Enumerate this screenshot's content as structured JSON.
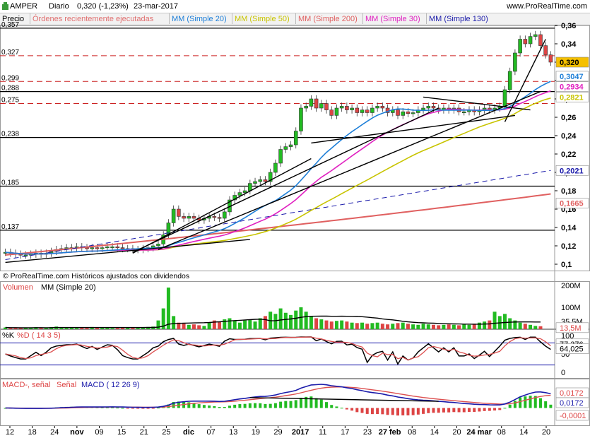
{
  "header": {
    "symbol": "AMPER",
    "period": "Diario",
    "quote": "0,320 (-1,23%)",
    "date": "23-mar-2017",
    "site": "www.ProRealTime.com"
  },
  "toolbar": {
    "price": "Precio",
    "orders": "Órdenes recientemente ejecutadas",
    "mm20": "MM (Simple 20)",
    "mm50": "MM (Simple 50)",
    "mm200": "MM (Simple 200)",
    "mm30": "MM (Simple 30)",
    "mm130": "MM (Simple 130)"
  },
  "price_panel": {
    "copyright": "© ProRealTime.com  Históricos ajustados con dividendos",
    "level_labels": [
      "0,357",
      "0,327",
      "0,299",
      "0,288",
      "0,275",
      "0,238",
      "0,185",
      "0,137"
    ],
    "price_badge": "0,320",
    "ma_badges": [
      "0,3047",
      "0,2934",
      "0,2821",
      "0,2021",
      "0,1665"
    ]
  },
  "volume_panel": {
    "label": "Volumen",
    "ma_label": "MM (Simple 20)",
    "axis": [
      "200M",
      "100M",
      "35,5M"
    ],
    "value_badge": "13,5M"
  },
  "stoch_panel": {
    "label_k": "%K",
    "label_d": "%D ( 14 3 5)",
    "axis": [
      "100",
      "50",
      "0"
    ],
    "badges": [
      "77,376",
      "64,025"
    ]
  },
  "macd_panel": {
    "label_macd": "MACD-, señal",
    "label_signal": "Señal",
    "label_params": "MACD ( 12 26 9)",
    "badges": [
      "0,0172",
      "0,0172",
      "-0,0001"
    ]
  },
  "colors": {
    "up": "#22bb22",
    "down": "#dd4444",
    "ma20": "#1e7fd8",
    "ma50": "#c8c400",
    "ma200": "#e06060",
    "ma30": "#e020c0",
    "ma130": "#1a1aaa",
    "badge_price": "#f5c000"
  },
  "chart_data": {
    "type": "candlestick",
    "x_ticks": [
      "12",
      "18",
      "24",
      "nov",
      "09",
      "15",
      "21",
      "25",
      "dic",
      "07",
      "13",
      "19",
      "29",
      "2017",
      "11",
      "17",
      "23",
      "27 feb",
      "08",
      "14",
      "20",
      "24 mar",
      "08",
      "14",
      "20"
    ],
    "price_axis": [
      "0,36",
      "0,34",
      "0,32",
      "0,30",
      "0,28",
      "0,26",
      "0,24",
      "0,22",
      "0,20",
      "0,18",
      "0,16",
      "0,14",
      "0,12",
      "0,1"
    ],
    "price_ylim": [
      0.1,
      0.36
    ],
    "horizontal_levels": [
      0.357,
      0.288,
      0.238,
      0.185,
      0.137
    ],
    "dashed_levels": [
      0.327,
      0.299,
      0.275
    ],
    "last_price": 0.32,
    "moving_averages_last": {
      "MM20": 0.3047,
      "MM30": 0.2934,
      "MM50": 0.2821,
      "MM130": 0.2021,
      "MM200": 0.1665
    },
    "close_approx": [
      0.113,
      0.112,
      0.111,
      0.11,
      0.11,
      0.111,
      0.112,
      0.111,
      0.112,
      0.114,
      0.116,
      0.117,
      0.118,
      0.118,
      0.119,
      0.118,
      0.117,
      0.118,
      0.117,
      0.118,
      0.119,
      0.119,
      0.118,
      0.117,
      0.117,
      0.116,
      0.116,
      0.117,
      0.118,
      0.12,
      0.122,
      0.132,
      0.145,
      0.16,
      0.152,
      0.15,
      0.152,
      0.15,
      0.148,
      0.15,
      0.152,
      0.151,
      0.15,
      0.157,
      0.17,
      0.175,
      0.178,
      0.18,
      0.188,
      0.19,
      0.192,
      0.19,
      0.2,
      0.21,
      0.225,
      0.228,
      0.23,
      0.245,
      0.27,
      0.272,
      0.28,
      0.27,
      0.275,
      0.268,
      0.262,
      0.27,
      0.272,
      0.268,
      0.27,
      0.265,
      0.268,
      0.265,
      0.27,
      0.272,
      0.27,
      0.265,
      0.268,
      0.262,
      0.266,
      0.264,
      0.265,
      0.268,
      0.27,
      0.272,
      0.27,
      0.268,
      0.27,
      0.268,
      0.27,
      0.266,
      0.266,
      0.268,
      0.266,
      0.268,
      0.27,
      0.268,
      0.27,
      0.272,
      0.29,
      0.31,
      0.33,
      0.345,
      0.34,
      0.348,
      0.35,
      0.338,
      0.328,
      0.32
    ],
    "volume_approx_M": [
      8,
      6,
      7,
      5,
      6,
      8,
      9,
      7,
      6,
      10,
      12,
      8,
      9,
      7,
      6,
      8,
      9,
      10,
      8,
      6,
      7,
      5,
      6,
      8,
      9,
      7,
      6,
      8,
      10,
      12,
      40,
      95,
      190,
      60,
      30,
      25,
      20,
      22,
      18,
      15,
      30,
      40,
      35,
      45,
      50,
      38,
      30,
      40,
      45,
      35,
      50,
      60,
      80,
      70,
      95,
      75,
      65,
      85,
      100,
      80,
      60,
      50,
      45,
      40,
      35,
      38,
      40,
      35,
      30,
      28,
      30,
      25,
      28,
      30,
      25,
      22,
      25,
      28,
      30,
      25,
      22,
      20,
      25,
      22,
      20,
      18,
      20,
      22,
      20,
      18,
      22,
      20,
      25,
      30,
      35,
      40,
      80,
      60,
      70,
      50,
      40,
      30,
      25,
      20,
      15,
      13.5
    ],
    "stoch_k_last": 77.376,
    "stoch_d_last": 64.025,
    "macd_last": 0.0172,
    "signal_last": 0.0172,
    "histogram_last": -0.0001
  }
}
